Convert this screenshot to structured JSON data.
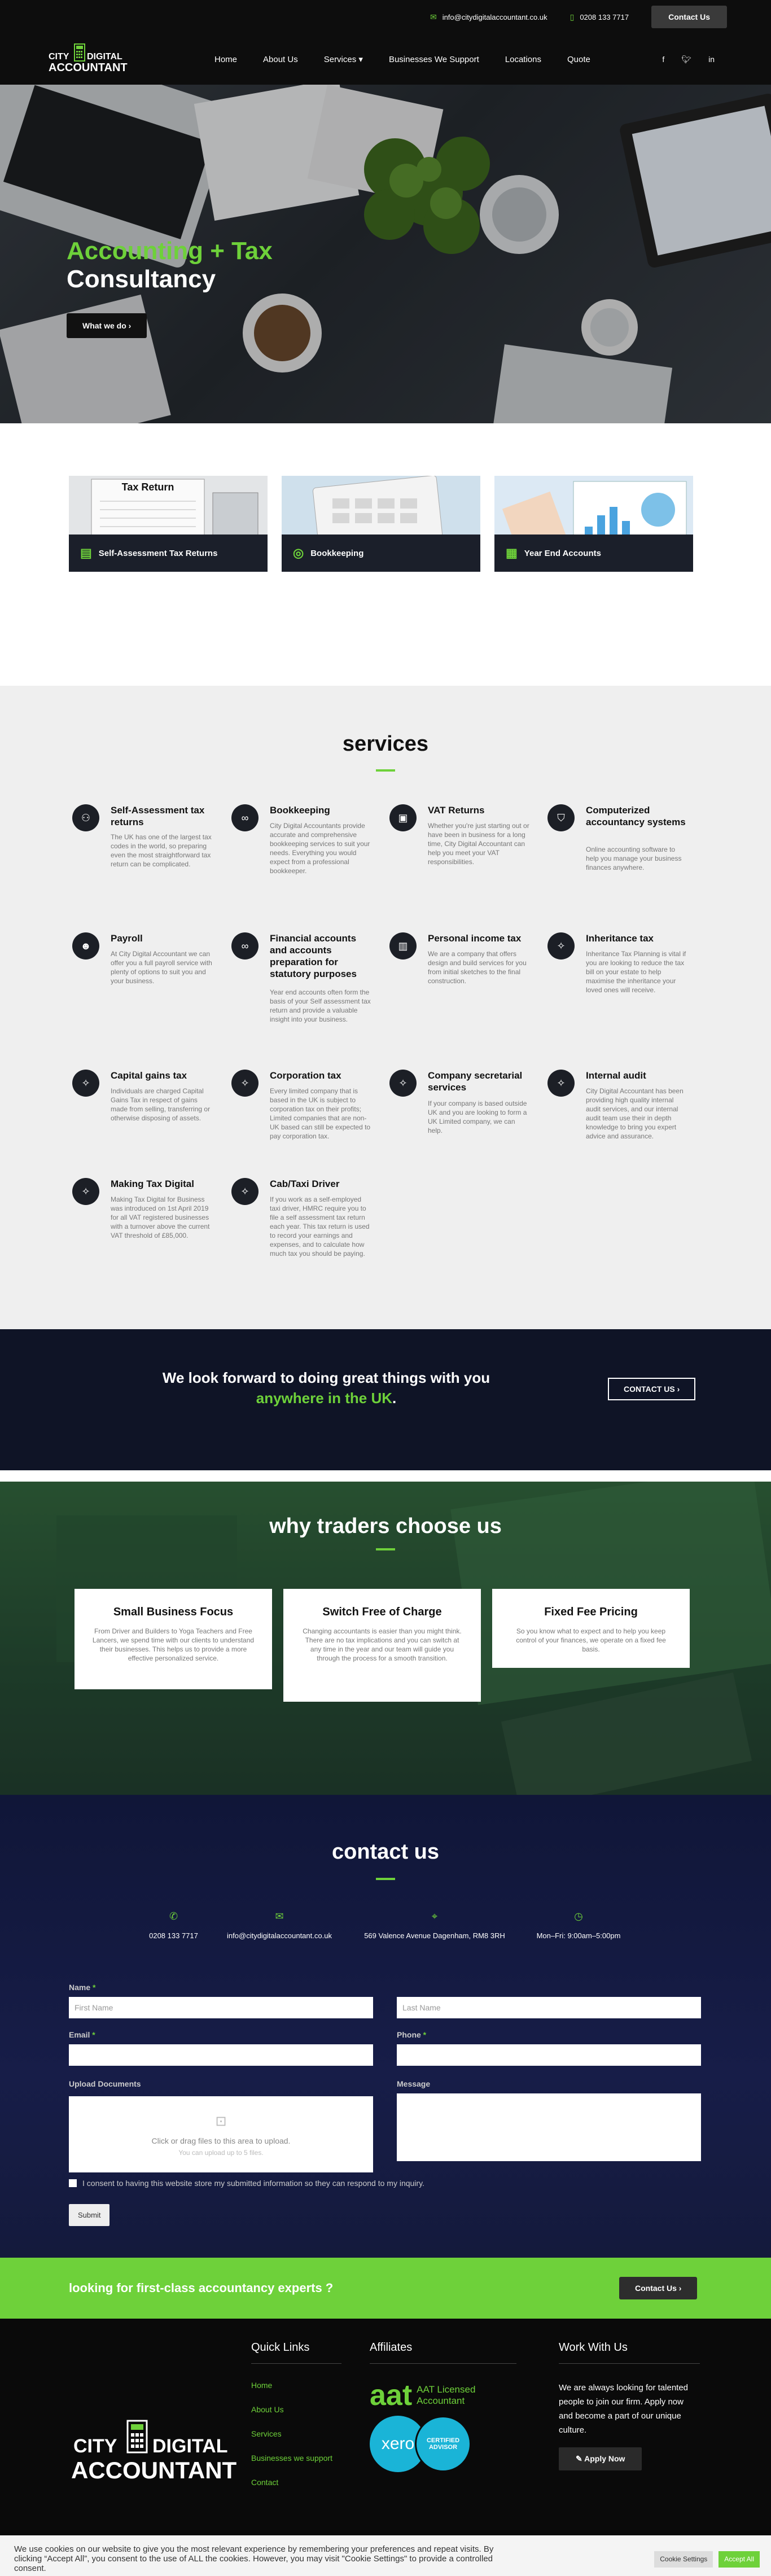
{
  "topbar": {
    "email": "info@citydigitalaccountant.co.uk",
    "phone": "0208 133 7717",
    "contact_btn": "Contact Us"
  },
  "brand": {
    "line1": "CITY",
    "line2": "DIGITAL",
    "line3": "ACCOUNTANT"
  },
  "nav": {
    "items": [
      "Home",
      "About Us",
      "Services",
      "Businesses We Support",
      "Locations",
      "Quote"
    ]
  },
  "hero": {
    "title_green": "Accounting + Tax",
    "title_white": "Consultancy",
    "button": "What we do"
  },
  "feature_cards": [
    {
      "label": "Self-Assessment Tax Returns",
      "image_text": "Tax Return"
    },
    {
      "label": "Bookkeeping"
    },
    {
      "label": "Year End Accounts"
    }
  ],
  "services": {
    "heading": "services",
    "items": [
      {
        "title": "Self-Assessment tax returns",
        "desc": "The UK has one of the largest tax codes in the world, so preparing even the most straightforward tax return can be complicated."
      },
      {
        "title": "Bookkeeping",
        "desc": "City Digital Accountants provide accurate and comprehensive bookkeeping services to suit your needs. Everything you would expect from a professional bookkeeper."
      },
      {
        "title": "VAT Returns",
        "desc": "Whether you're just starting out or have been in business for a long time, City Digital Accountant can help you meet your VAT responsibilities."
      },
      {
        "title": "Computerized accountancy systems",
        "desc": "Online accounting software to help you manage your business finances anywhere."
      },
      {
        "title": "Payroll",
        "desc": "At City Digital Accountant we can offer you a full payroll service with plenty of options to suit you and your business."
      },
      {
        "title": "Financial accounts and accounts preparation for statutory purposes",
        "desc": "Year end accounts often form the basis of your Self assessment tax return and provide a valuable insight into your business."
      },
      {
        "title": "Personal income tax",
        "desc": "We are a company that offers design and build services for you from initial sketches to the final construction."
      },
      {
        "title": "Inheritance tax",
        "desc": "Inheritance Tax Planning is vital if you are looking to reduce the tax bill on your estate to help maximise the inheritance your loved ones will receive."
      },
      {
        "title": "Capital gains tax",
        "desc": "Individuals are charged Capital Gains Tax in respect of gains made from selling, transferring or otherwise disposing of assets."
      },
      {
        "title": "Corporation tax",
        "desc": "Every limited company that is based in the UK is subject to corporation tax on their profits; Limited companies that are non-UK based can still be expected to pay corporation tax."
      },
      {
        "title": "Company secretarial services",
        "desc": "If your company is based outside UK and you are looking to form a UK Limited company, we can help."
      },
      {
        "title": "Internal audit",
        "desc": "City Digital Accountant has been providing high quality internal audit services, and our internal audit team use their in depth knowledge to bring you expert advice and assurance."
      },
      {
        "title": "Making Tax Digital",
        "desc": "Making Tax Digital for Business was introduced on 1st April 2019 for all VAT registered businesses with a turnover above the current VAT threshold of £85,000."
      },
      {
        "title": "Cab/Taxi Driver",
        "desc": "If you work as a self-employed taxi driver, HMRC require you to file a self assessment tax return each year. This tax return is used to record your earnings and expenses, and to calculate how much tax you should be paying."
      }
    ]
  },
  "banner": {
    "text": "We look forward to doing great things with you",
    "highlight": "anywhere in the UK",
    "button": "CONTACT US"
  },
  "why": {
    "heading": "why traders choose us",
    "cards": [
      {
        "title": "Small Business Focus",
        "desc": "From Driver and Builders to Yoga Teachers and Free Lancers, we spend time with our clients to understand their businesses. This helps us to provide a more effective personalized service."
      },
      {
        "title": "Switch Free of Charge",
        "desc": "Changing accountants is easier than you might think. There are no tax implications and you can switch at any time in the year and our team will guide you through the process for a smooth transition."
      },
      {
        "title": "Fixed Fee Pricing",
        "desc": "So you know what to expect and to help you keep control of your finances, we operate on a fixed fee basis."
      }
    ]
  },
  "contact": {
    "heading": "contact us",
    "info": [
      "0208 133 7717",
      "info@citydigitalaccountant.co.uk",
      "569 Valence Avenue Dagenham, RM8 3RH",
      "Mon–Fri: 9:00am–5:00pm"
    ],
    "form": {
      "name_label": "Name",
      "first_ph": "First Name",
      "last_ph": "Last Name",
      "email_label": "Email",
      "phone_label": "Phone",
      "upload_label": "Upload Documents",
      "upload_text": "Click or drag files to this area to upload.",
      "upload_sub": "You can upload up to 5 files.",
      "message_label": "Message",
      "consent": "I consent to having this website store my submitted information so they can respond to my inquiry.",
      "submit": "Submit"
    }
  },
  "cta": {
    "text": "looking for first-class accountancy experts ?",
    "button": "Contact Us"
  },
  "footer": {
    "quick_links_title": "Quick Links",
    "quick_links": [
      "Home",
      "About Us",
      "Services",
      "Businesses we support",
      "Contact"
    ],
    "affiliates_title": "Affiliates",
    "aat_text": "AAT Licensed Accountant",
    "xero_text": "xero",
    "xero_badge": "CERTIFIED ADVISOR",
    "work_title": "Work With Us",
    "work_text": "We are always looking for talented people to join our firm. Apply now and become a part of our unique culture.",
    "apply_btn": "Apply Now"
  },
  "cookie": {
    "text": "We use cookies on our website to give you the most relevant experience by remembering your preferences and repeat visits. By clicking “Accept All”, you consent to the use of ALL the cookies. However, you may visit \"Cookie Settings\" to provide a controlled consent.",
    "settings": "Cookie Settings",
    "accept": "Accept All"
  },
  "colors": {
    "accent": "#6ed13a",
    "dark": "#0d0d0d",
    "navy": "#101638"
  }
}
